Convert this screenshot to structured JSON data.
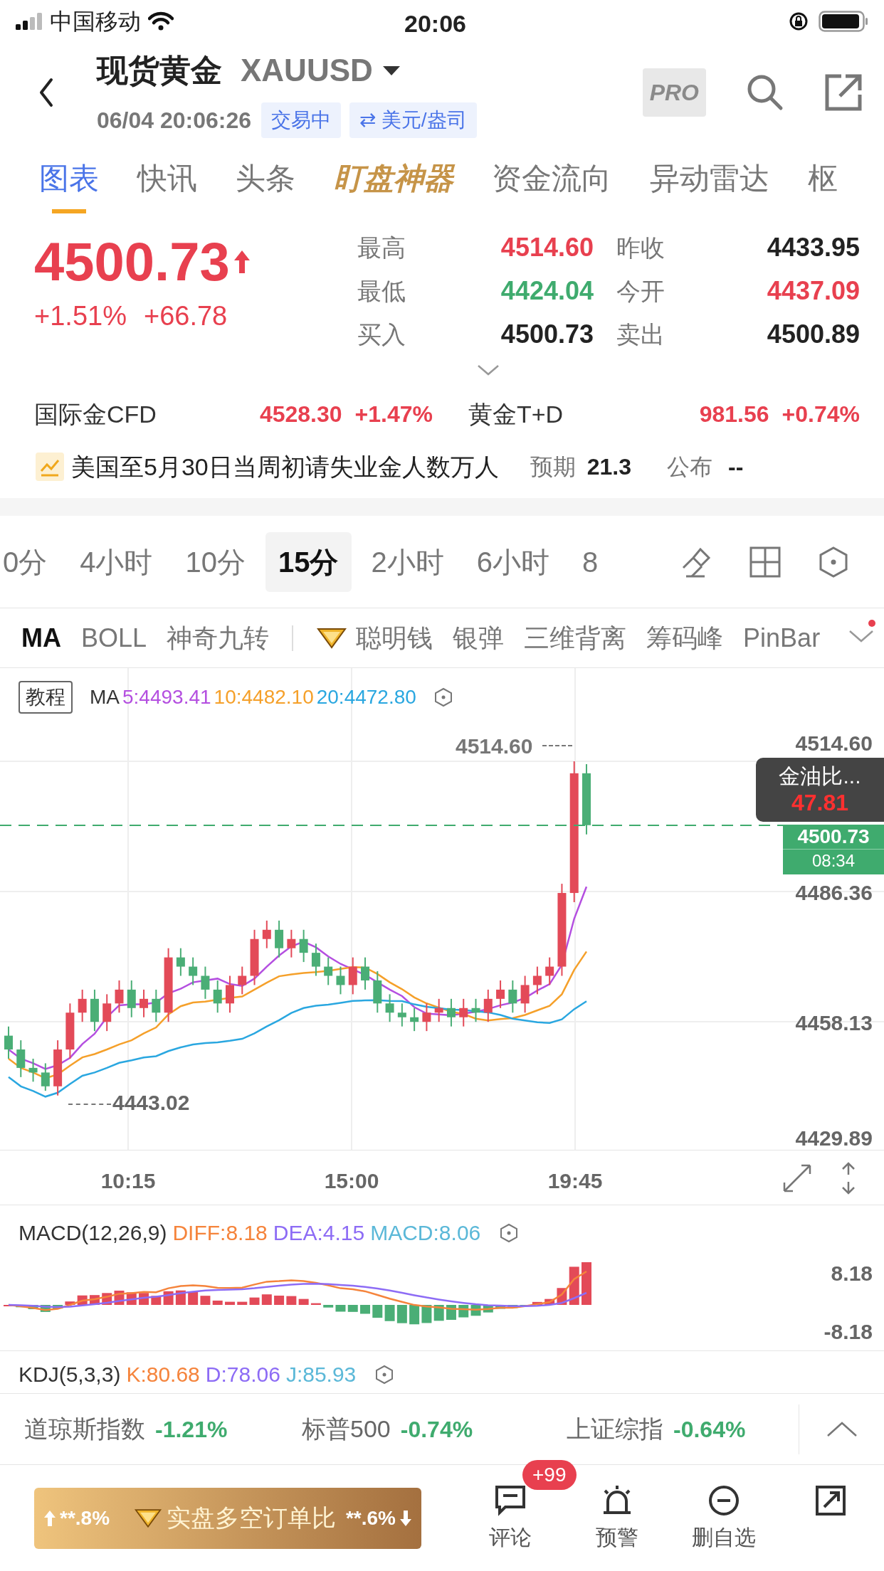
{
  "status_bar": {
    "carrier": "中国移动",
    "time": "20:06"
  },
  "header": {
    "title": "现货黄金",
    "symbol": "XAUUSD",
    "datetime": "06/04 20:06:26",
    "tags": [
      "交易中",
      "⇄ 美元/盎司"
    ],
    "pro": "PRO"
  },
  "tabs": [
    {
      "label": "图表",
      "selected": true,
      "kind": "plain"
    },
    {
      "label": "快讯",
      "selected": false,
      "kind": "plain"
    },
    {
      "label": "头条",
      "selected": false,
      "kind": "plain"
    },
    {
      "label": "盯盘神器",
      "selected": false,
      "kind": "promo"
    },
    {
      "label": "资金流向",
      "selected": false,
      "kind": "plain"
    },
    {
      "label": "异动雷达",
      "selected": false,
      "kind": "plain"
    },
    {
      "label": "枢",
      "selected": false,
      "kind": "plain"
    }
  ],
  "quote": {
    "price": "4500.73",
    "color": "#e8404f",
    "change_pct": "+1.51%",
    "change": "+66.78",
    "stats": [
      {
        "label": "最高",
        "value": "4514.60",
        "color": "#e8404f"
      },
      {
        "label": "昨收",
        "value": "4433.95",
        "color": "#222222"
      },
      {
        "label": "最低",
        "value": "4424.04",
        "color": "#3fab6e"
      },
      {
        "label": "今开",
        "value": "4437.09",
        "color": "#e8404f"
      },
      {
        "label": "买入",
        "value": "4500.73",
        "color": "#222222"
      },
      {
        "label": "卖出",
        "value": "4500.89",
        "color": "#222222"
      }
    ]
  },
  "related": [
    {
      "name": "国际金CFD",
      "price": "4528.30",
      "change": "+1.47%",
      "color": "#e8404f"
    },
    {
      "name": "黄金T+D",
      "price": "981.56",
      "change": "+0.74%",
      "color": "#e8404f"
    }
  ],
  "event": {
    "title": "美国至5月30日当周初请失业金人数万人",
    "forecast_label": "预期",
    "forecast": "21.3",
    "actual_label": "公布",
    "actual": "--"
  },
  "timeframes": [
    {
      "label": "0分",
      "selected": false
    },
    {
      "label": "4小时",
      "selected": false
    },
    {
      "label": "10分",
      "selected": false
    },
    {
      "label": "15分",
      "selected": true
    },
    {
      "label": "2小时",
      "selected": false
    },
    {
      "label": "6小时",
      "selected": false
    },
    {
      "label": "8",
      "selected": false
    }
  ],
  "indicators": [
    {
      "label": "MA",
      "selected": true,
      "kind": "plain"
    },
    {
      "label": "BOLL",
      "selected": false,
      "kind": "plain"
    },
    {
      "label": "神奇九转",
      "selected": false,
      "kind": "plain"
    },
    {
      "label": "聪明钱",
      "selected": false,
      "kind": "premium"
    },
    {
      "label": "银弹",
      "selected": false,
      "kind": "plain"
    },
    {
      "label": "三维背离",
      "selected": false,
      "kind": "plain"
    },
    {
      "label": "筹码峰",
      "selected": false,
      "kind": "plain"
    },
    {
      "label": "PinBar",
      "selected": false,
      "kind": "plain"
    }
  ],
  "indicator_menu": {
    "has_new": true
  },
  "chart": {
    "tutorial": "教程",
    "ma_label": "MA",
    "ma_values": [
      {
        "text": "5:4493.41",
        "color": "#b44fe0"
      },
      {
        "text": "10:4482.10",
        "color": "#f5a02a"
      },
      {
        "text": "20:4472.80",
        "color": "#2aa7e0"
      }
    ],
    "y_labels": [
      "4514.60",
      "4486.36",
      "4458.13",
      "4429.89"
    ],
    "high_marker": "4514.60",
    "low_marker": "4443.02",
    "tooltip": {
      "title": "金油比...",
      "value": "47.81"
    },
    "price_tag": {
      "price": "4500.73",
      "countdown": "08:34"
    },
    "x_labels": [
      "10:15",
      "15:00",
      "19:45"
    ]
  },
  "macd": {
    "label": "MACD(12,26,9)",
    "values": [
      {
        "text": "DIFF:8.18",
        "color": "#f5843c"
      },
      {
        "text": "DEA:4.15",
        "color": "#8d6cf5"
      },
      {
        "text": "MACD:8.06",
        "color": "#5bb8d8"
      }
    ],
    "y_labels": [
      "8.18",
      "-8.18"
    ]
  },
  "kdj": {
    "label": "KDJ(5,3,3)",
    "values": [
      {
        "text": "K:80.68",
        "color": "#f5843c"
      },
      {
        "text": "D:78.06",
        "color": "#8d6cf5"
      },
      {
        "text": "J:85.93",
        "color": "#5bb8d8"
      }
    ]
  },
  "indices": [
    {
      "name": "道琼斯指数",
      "change": "-1.21%",
      "color": "#3fab6e"
    },
    {
      "name": "标普500",
      "change": "-0.74%",
      "color": "#3fab6e"
    },
    {
      "name": "上证综指",
      "change": "-0.64%",
      "color": "#3fab6e"
    }
  ],
  "bottom": {
    "ratio": {
      "long": "**.8%",
      "title": "实盘多空订单比",
      "short": "**.6%"
    },
    "actions": [
      {
        "label": "评论",
        "kind": "comment",
        "badge": "+99"
      },
      {
        "label": "预警",
        "kind": "alert"
      },
      {
        "label": "删自选",
        "kind": "remove"
      },
      {
        "kind": "share"
      }
    ]
  }
}
